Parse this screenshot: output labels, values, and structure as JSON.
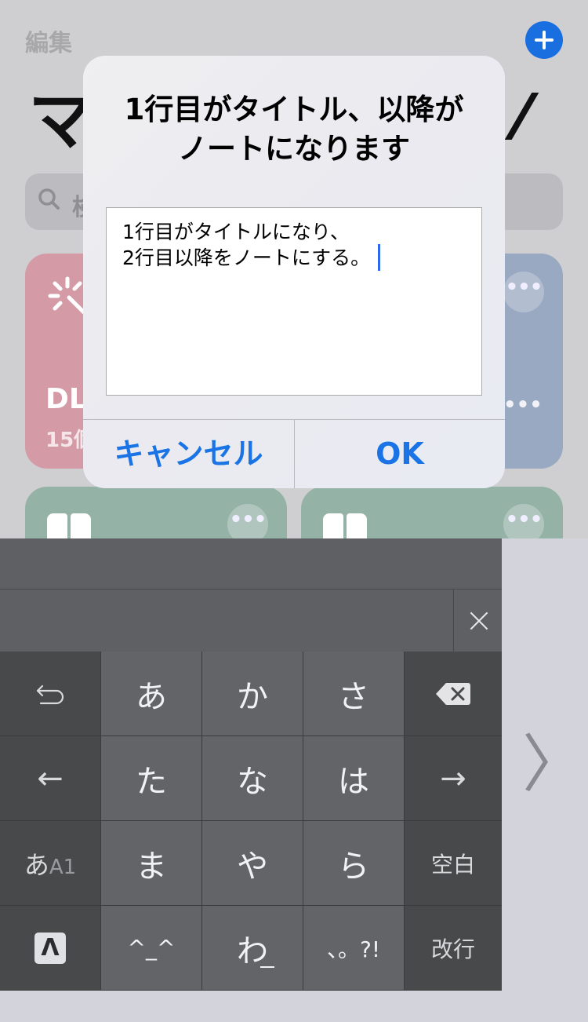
{
  "background": {
    "edit_label": "編集",
    "big_title": "マ",
    "search_text": "検",
    "cards": [
      {
        "title": "DL",
        "subtitle": "15個",
        "color": "#d49aa6"
      },
      {
        "title": "",
        "subtitle": "",
        "color": "#99a9c1"
      },
      {
        "title": "",
        "subtitle": "",
        "color": "#95b2a7"
      },
      {
        "title": "",
        "subtitle": "",
        "color": "#95b2a7"
      }
    ],
    "accent": "#1a6fe0"
  },
  "dialog": {
    "title": "1行目がタイトル、以降がノートになります",
    "input_value": "1行目がタイトルになり、\n2行目以降をノートにする。",
    "cancel_label": "キャンセル",
    "ok_label": "OK",
    "button_color": "#1a74e6"
  },
  "keyboard": {
    "row1": [
      "あ",
      "か",
      "さ"
    ],
    "row2": [
      "た",
      "な",
      "は"
    ],
    "row3": [
      "ま",
      "や",
      "ら"
    ],
    "row4": [
      "^_^",
      "わ",
      "、。?!"
    ],
    "left_arrow": "←",
    "right_arrow": "→",
    "mode_main": "あ",
    "mode_sub": "A1",
    "space_label": "空白",
    "return_label": "改行",
    "logo_letter": "Λ",
    "next_arrow": "〉"
  }
}
